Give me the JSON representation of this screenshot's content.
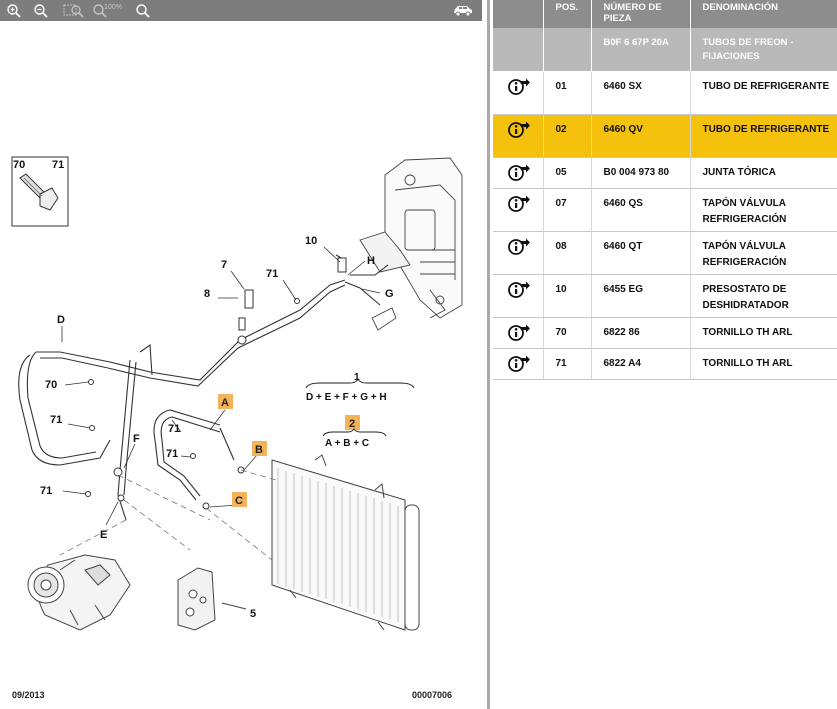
{
  "toolbar": {
    "buttons": [
      {
        "name": "zoom-in-icon",
        "enabled": true
      },
      {
        "name": "zoom-out-icon",
        "enabled": true
      },
      {
        "name": "zoom-area-icon",
        "enabled": false
      },
      {
        "name": "zoom-100-icon",
        "label": "100%",
        "enabled": false
      },
      {
        "name": "zoom-reset-icon",
        "enabled": true
      }
    ],
    "vehicle_icon": "car-icon"
  },
  "diagram": {
    "date": "09/2013",
    "ref": "00007006",
    "callouts": [
      "70",
      "71",
      "10",
      "H",
      "7",
      "71",
      "8",
      "G",
      "D",
      "70",
      "71",
      "F",
      "71",
      "71",
      "71",
      "E",
      "5"
    ],
    "box_labels": [
      "A",
      "B",
      "C",
      "2"
    ],
    "formula1": {
      "num": "1",
      "text": "D + E + F + G + H"
    },
    "formula2": {
      "num": "2",
      "text": "A + B + C"
    }
  },
  "table": {
    "headers": {
      "pos": "POS.",
      "part_no": "NÚMERO DE PIEZA",
      "name": "DENOMINACIÓN"
    },
    "subheader": {
      "part_no": "B0F 6 67P 20A",
      "name": "TUBOS DE FREON - FIJACIONES"
    },
    "rows": [
      {
        "pos": "01",
        "part_no": "6460 SX",
        "name": "TUBO DE REFRIGERANTE",
        "selected": false
      },
      {
        "pos": "02",
        "part_no": "6460 QV",
        "name": "TUBO DE REFRIGERANTE",
        "selected": true
      },
      {
        "pos": "05",
        "part_no": "B0 004 973 80",
        "name": "JUNTA TÓRICA",
        "selected": false
      },
      {
        "pos": "07",
        "part_no": "6460 QS",
        "name": "TAPÓN VÁLVULA REFRIGERACIÓN",
        "selected": false
      },
      {
        "pos": "08",
        "part_no": "6460 QT",
        "name": "TAPÓN VÁLVULA REFRIGERACIÓN",
        "selected": false
      },
      {
        "pos": "10",
        "part_no": "6455 EG",
        "name": "PRESOSTATO DE DESHIDRATADOR",
        "selected": false
      },
      {
        "pos": "70",
        "part_no": "6822 86",
        "name": "TORNILLO TH ARL",
        "selected": false
      },
      {
        "pos": "71",
        "part_no": "6822 A4",
        "name": "TORNILLO TH ARL",
        "selected": false
      }
    ],
    "row_icon": "info-link-icon",
    "selected_color": "#f4c20d"
  }
}
